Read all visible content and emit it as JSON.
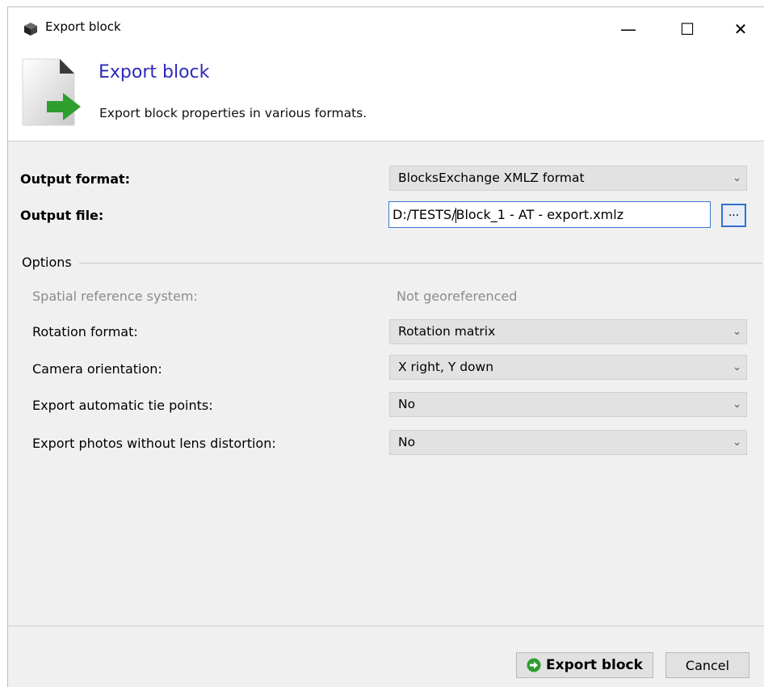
{
  "window": {
    "title": "Export block",
    "controls": {
      "minimize": "—",
      "maximize": "☐",
      "close": "✕"
    }
  },
  "header": {
    "title": "Export block",
    "subtitle": "Export block properties in various formats."
  },
  "form": {
    "output_format": {
      "label": "Output format:",
      "value": "BlocksExchange XMLZ format"
    },
    "output_file": {
      "label": "Output file:",
      "value_before_caret": "D:/TESTS/",
      "value_after_caret": "Block_1 - AT - export.xmlz",
      "browse_label": "..."
    }
  },
  "options": {
    "title": "Options",
    "spatial_reference": {
      "label": "Spatial reference system:",
      "value": "Not georeferenced"
    },
    "rotation_format": {
      "label": "Rotation format:",
      "value": "Rotation matrix"
    },
    "camera_orientation": {
      "label": "Camera orientation:",
      "value": "X right, Y down"
    },
    "export_tie_points": {
      "label": "Export automatic tie points:",
      "value": "No"
    },
    "export_photos": {
      "label": "Export photos without lens distortion:",
      "value": "No"
    }
  },
  "footer": {
    "export_label": "Export block",
    "cancel_label": "Cancel"
  },
  "colors": {
    "accent_title": "#2b2bb8",
    "arrow_green": "#2e9e2e",
    "focus_blue": "#3a78d0"
  }
}
